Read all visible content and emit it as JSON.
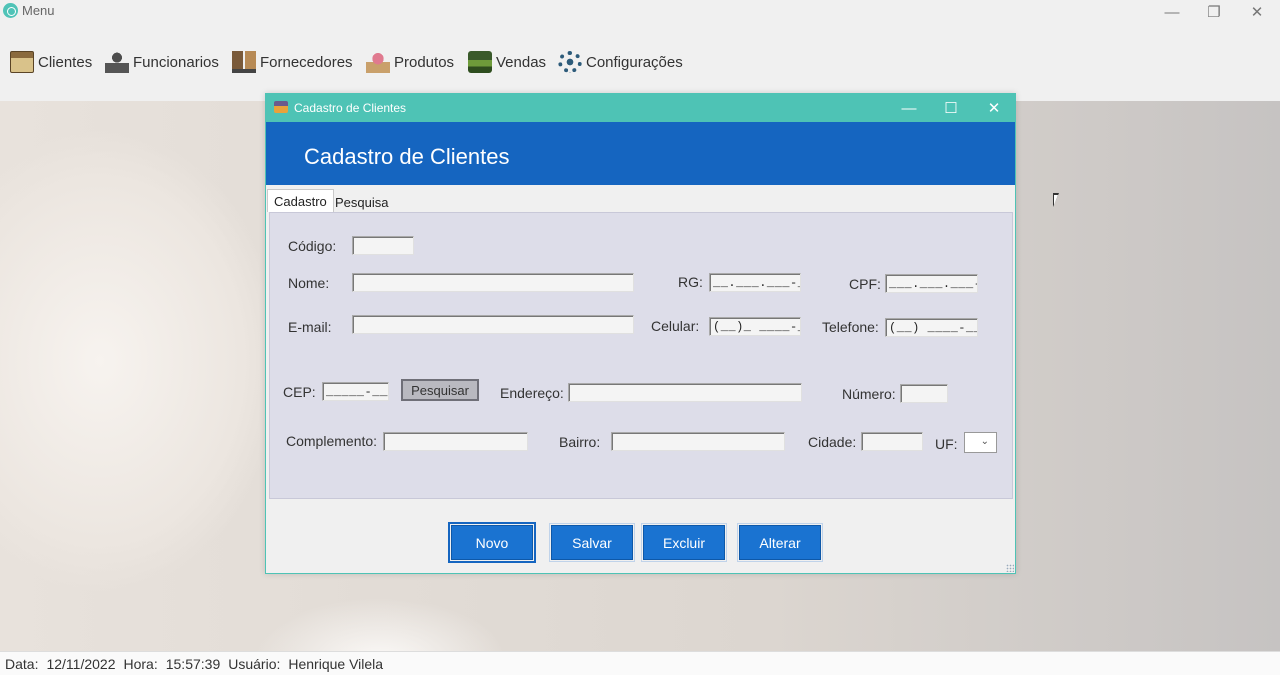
{
  "app": {
    "title": "Menu"
  },
  "window_controls": {
    "minimize": "—",
    "maximize": "❐",
    "close": "✕"
  },
  "menu": [
    {
      "label": "Clientes",
      "icon": "clientes-icon"
    },
    {
      "label": "Funcionarios",
      "icon": "funcionarios-icon"
    },
    {
      "label": "Fornecedores",
      "icon": "fornecedores-icon"
    },
    {
      "label": "Produtos",
      "icon": "produtos-icon"
    },
    {
      "label": "Vendas",
      "icon": "vendas-icon"
    },
    {
      "label": "Configurações",
      "icon": "configuracoes-icon"
    }
  ],
  "child": {
    "title": "Cadastro de Clientes",
    "header": "Cadastro de Clientes",
    "controls": {
      "minimize": "—",
      "maximize": "☐",
      "close": "✕"
    },
    "tabs": [
      "Cadastro",
      "Pesquisa"
    ],
    "form": {
      "codigo_label": "Código:",
      "codigo_value": "",
      "nome_label": "Nome:",
      "nome_value": "",
      "rg_label": "RG:",
      "rg_mask": "__.___.___-_",
      "cpf_label": "CPF:",
      "cpf_mask": "___.___.___-__",
      "email_label": "E-mail:",
      "email_value": "",
      "celular_label": "Celular:",
      "celular_mask": "(__)_ ____-____",
      "telefone_label": "Telefone:",
      "telefone_mask": "(__) ____-____",
      "cep_label": "CEP:",
      "cep_mask": "_____-___",
      "pesquisar_label": "Pesquisar",
      "endereco_label": "Endereço:",
      "endereco_value": "",
      "numero_label": "Número:",
      "numero_value": "",
      "complemento_label": "Complemento:",
      "complemento_value": "",
      "bairro_label": "Bairro:",
      "bairro_value": "",
      "cidade_label": "Cidade:",
      "cidade_value": "",
      "uf_label": "UF:",
      "uf_value": ""
    },
    "buttons": {
      "novo": "Novo",
      "salvar": "Salvar",
      "excluir": "Excluir",
      "alterar": "Alterar"
    }
  },
  "status": {
    "data_label": "Data:",
    "data_value": "12/11/2022",
    "hora_label": "Hora:",
    "hora_value": "15:57:39",
    "usuario_label": "Usuário:",
    "usuario_value": "Henrique Vilela"
  },
  "colors": {
    "accent_teal": "#4ec3b5",
    "header_blue": "#1565c0",
    "button_blue": "#1a73d1",
    "panel": "#dddde9"
  }
}
